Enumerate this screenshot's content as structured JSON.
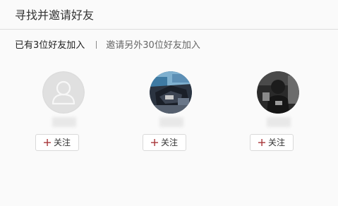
{
  "header": {
    "title": "寻找并邀请好友"
  },
  "subbar": {
    "joined_text": "已有3位好友加入",
    "invite_text": "邀请另外30位好友加入"
  },
  "friends": [
    {
      "avatar": "default-avatar-icon",
      "follow_label": "关注"
    },
    {
      "avatar": "photo-avatar",
      "follow_label": "关注"
    },
    {
      "avatar": "photo-avatar",
      "follow_label": "关注"
    }
  ],
  "colors": {
    "plus_icon": "#a8373a",
    "background": "#fafafa",
    "divider": "#dedede"
  }
}
